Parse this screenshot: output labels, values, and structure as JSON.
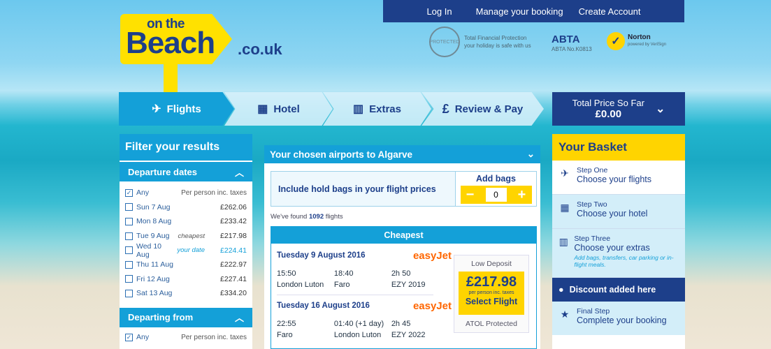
{
  "top_nav": {
    "login": "Log In",
    "manage": "Manage your booking",
    "create": "Create Account"
  },
  "logo": {
    "on_the": "on the",
    "beach": "Beach",
    "domain": ".co.uk"
  },
  "trust": {
    "tfp_seal": "PROTECTED",
    "tfp_title": "Total Financial Protection",
    "tfp_sub": "your holiday is safe with us",
    "abta_logo": "ABTA",
    "abta_no": "ABTA No.K0813",
    "norton": "Norton",
    "norton_sub": "powered by VeriSign"
  },
  "steps": {
    "flights": "Flights",
    "hotel": "Hotel",
    "extras": "Extras",
    "review": "Review & Pay",
    "total_label": "Total Price So Far",
    "total_value": "£0.00"
  },
  "filter": {
    "title": "Filter your results",
    "departure_dates": {
      "title": "Departure dates",
      "header_label": "Any",
      "header_right": "Per person inc. taxes",
      "rows": [
        {
          "label": "Sun 7 Aug",
          "note": "",
          "price": "£262.06"
        },
        {
          "label": "Mon 8 Aug",
          "note": "",
          "price": "£233.42"
        },
        {
          "label": "Tue 9 Aug",
          "note": "cheapest",
          "price": "£217.98"
        },
        {
          "label": "Wed 10 Aug",
          "note": "your date",
          "price": "£224.41"
        },
        {
          "label": "Thu 11 Aug",
          "note": "",
          "price": "£222.97"
        },
        {
          "label": "Fri 12 Aug",
          "note": "",
          "price": "£227.41"
        },
        {
          "label": "Sat 13 Aug",
          "note": "",
          "price": "£334.20"
        }
      ]
    },
    "departing_from": {
      "title": "Departing from",
      "header_label": "Any",
      "header_right": "Per person inc. taxes"
    }
  },
  "results": {
    "title": "Your chosen airports to Algarve",
    "bags_text": "Include hold bags in your flight prices",
    "add_bags": "Add bags",
    "bags_count": "0",
    "found_pre": "We've found",
    "found_count": "1092",
    "found_post": "flights",
    "cheapest_title": "Cheapest",
    "outbound": {
      "date": "Tuesday 9 August 2016",
      "airline": "easyJet",
      "dep_time": "15:50",
      "arr_time": "18:40",
      "duration": "2h 50",
      "from": "London Luton",
      "to": "Faro",
      "flight": "EZY 2019"
    },
    "inbound": {
      "date": "Tuesday 16 August 2016",
      "airline": "easyJet",
      "dep_time": "22:55",
      "arr_time": "01:40 (+1 day)",
      "duration": "2h 45",
      "from": "Faro",
      "to": "London Luton",
      "flight": "EZY 2022"
    },
    "low_deposit": "Low Deposit",
    "price": "£217.98",
    "per_person": "per person inc. taxes",
    "select": "Select Flight",
    "atol": "ATOL Protected"
  },
  "basket": {
    "title": "Your Basket",
    "steps": [
      {
        "step": "Step One",
        "text": "Choose your flights",
        "note": ""
      },
      {
        "step": "Step Two",
        "text": "Choose your hotel",
        "note": ""
      },
      {
        "step": "Step Three",
        "text": "Choose your extras",
        "note": "Add bags, transfers, car parking or in-flight meals."
      }
    ],
    "discount": "Discount added here",
    "final_step": "Final Step",
    "final_text": "Complete your booking"
  }
}
